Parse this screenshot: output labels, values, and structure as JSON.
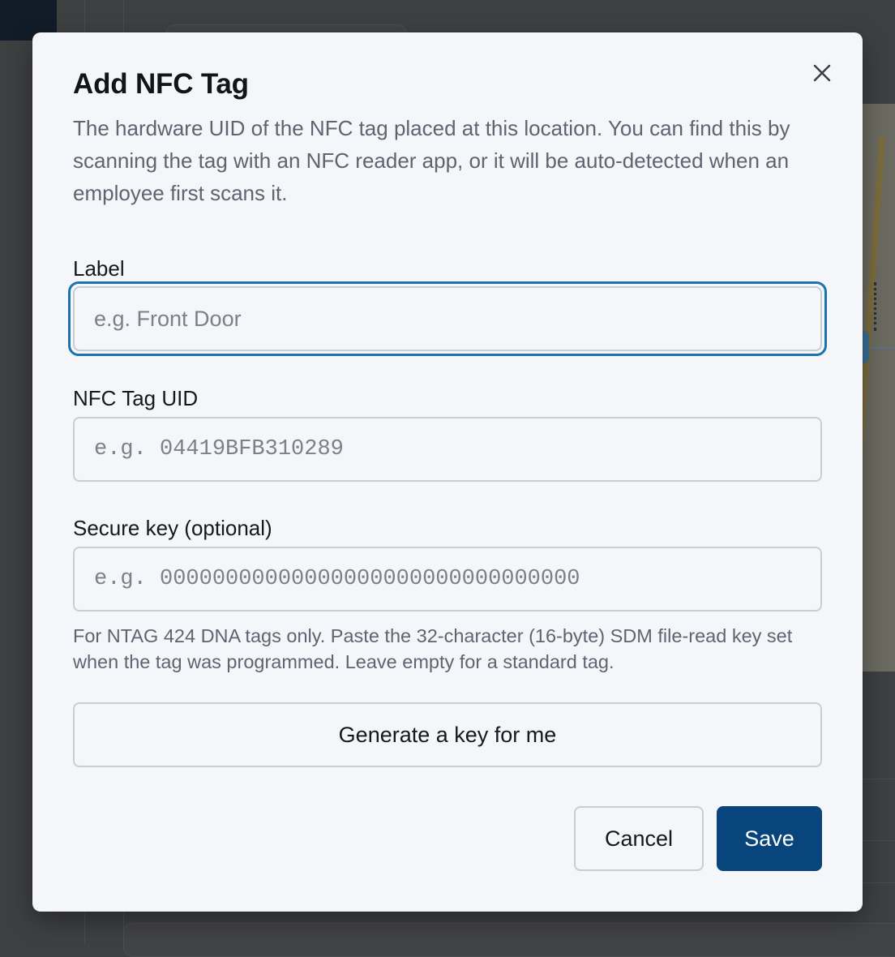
{
  "modal": {
    "title": "Add NFC Tag",
    "description": "The hardware UID of the NFC tag placed at this location. You can find this by scanning the tag with an NFC reader app, or it will be auto-detected when an employee first scans it.",
    "close_icon": "close-icon",
    "fields": {
      "label": {
        "label": "Label",
        "value": "",
        "placeholder": "e.g. Front Door",
        "focused": true
      },
      "uid": {
        "label": "NFC Tag UID",
        "value": "",
        "placeholder": "e.g. 04419BFB310289"
      },
      "secure_key": {
        "label": "Secure key (optional)",
        "value": "",
        "placeholder": "e.g. 00000000000000000000000000000000",
        "help": "For NTAG 424 DNA tags only. Paste the 32-character (16-byte) SDM file-read key set when the tag was programmed. Leave empty for a standard tag."
      }
    },
    "buttons": {
      "generate": "Generate a key for me",
      "cancel": "Cancel",
      "save": "Save"
    }
  },
  "colors": {
    "overlay": "#3e3f41",
    "modal_bg": "#f4f6fa",
    "primary": "#07457c",
    "focus_ring": "#1a74ad",
    "border": "#c9cdd3",
    "muted_text": "#5f6470"
  }
}
